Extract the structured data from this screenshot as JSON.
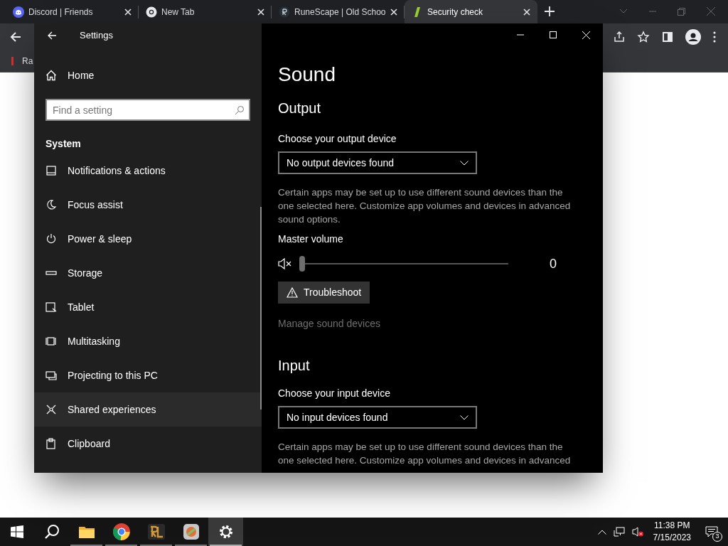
{
  "browser": {
    "tabs": [
      {
        "title": "Discord | Friends",
        "selected": false
      },
      {
        "title": "New Tab",
        "selected": false
      },
      {
        "title": "RuneScape | Old Schoo",
        "selected": false
      },
      {
        "title": "Security check",
        "selected": true
      }
    ],
    "bookmarks": [
      {
        "label": "Ra"
      }
    ]
  },
  "settings": {
    "window_title": "Settings",
    "home": "Home",
    "search": {
      "placeholder": "Find a setting"
    },
    "section": "System",
    "nav_items": [
      {
        "label": "Notifications & actions",
        "hovered": false
      },
      {
        "label": "Focus assist",
        "hovered": false
      },
      {
        "label": "Power & sleep",
        "hovered": false
      },
      {
        "label": "Storage",
        "hovered": false
      },
      {
        "label": "Tablet",
        "hovered": false
      },
      {
        "label": "Multitasking",
        "hovered": false
      },
      {
        "label": "Projecting to this PC",
        "hovered": false
      },
      {
        "label": "Shared experiences",
        "hovered": true
      },
      {
        "label": "Clipboard",
        "hovered": false
      }
    ],
    "page_title": "Sound",
    "output": {
      "heading": "Output",
      "label": "Choose your output device",
      "device": "No output devices found",
      "note": "Certain apps may be set up to use different sound devices than the one selected here. Customize app volumes and devices in advanced sound options."
    },
    "master_volume": {
      "label": "Master volume",
      "level": 0,
      "reading": "0"
    },
    "troubleshoot": "Troubleshoot",
    "manage_link": {
      "label": "Manage sound devices",
      "disabled": true
    },
    "input": {
      "heading": "Input",
      "label": "Choose your input device",
      "device": "No input devices found",
      "note": "Certain apps may be set up to use different sound devices than the one selected here. Customize app volumes and devices in advanced"
    }
  },
  "taskbar": {
    "apps": [
      {
        "selected": false,
        "running": false
      },
      {
        "selected": false,
        "running": true
      },
      {
        "selected": false,
        "running": true
      },
      {
        "selected": false,
        "running": true
      },
      {
        "selected": false,
        "running": true
      },
      {
        "selected": true,
        "running": true
      }
    ],
    "time": "11:38 PM",
    "date": "7/15/2023",
    "notifications": "3"
  }
}
